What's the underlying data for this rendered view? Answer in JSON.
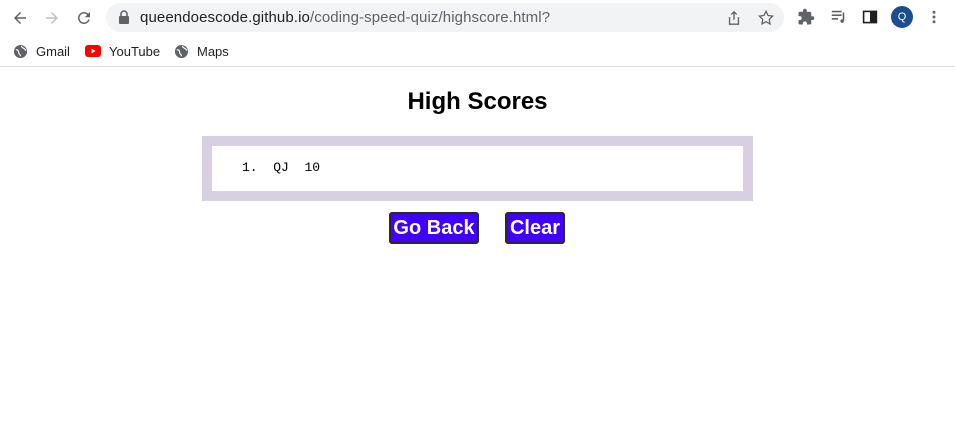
{
  "browser": {
    "url_host": "queendoescode.github.io",
    "url_path": "/coding-speed-quiz/highscore.html?",
    "profile_initial": "Q",
    "icons": [
      "back-arrow-icon",
      "forward-arrow-icon",
      "reload-icon",
      "lock-icon",
      "share-icon",
      "star-icon",
      "extensions-icon",
      "reading-list-icon",
      "side-panel-icon",
      "menu-icon"
    ]
  },
  "bookmarks": [
    {
      "label": "Gmail",
      "icon": "globe-icon"
    },
    {
      "label": "YouTube",
      "icon": "youtube-icon"
    },
    {
      "label": "Maps",
      "icon": "globe-icon"
    }
  ],
  "page": {
    "title": "High Scores",
    "scores": [
      {
        "rank": "1.",
        "initials": "QJ",
        "score": "10"
      }
    ],
    "go_back_label": "Go Back",
    "clear_label": "Clear"
  },
  "colors": {
    "button_bg": "#4000ff",
    "score_box_border": "#d8cfe3"
  }
}
